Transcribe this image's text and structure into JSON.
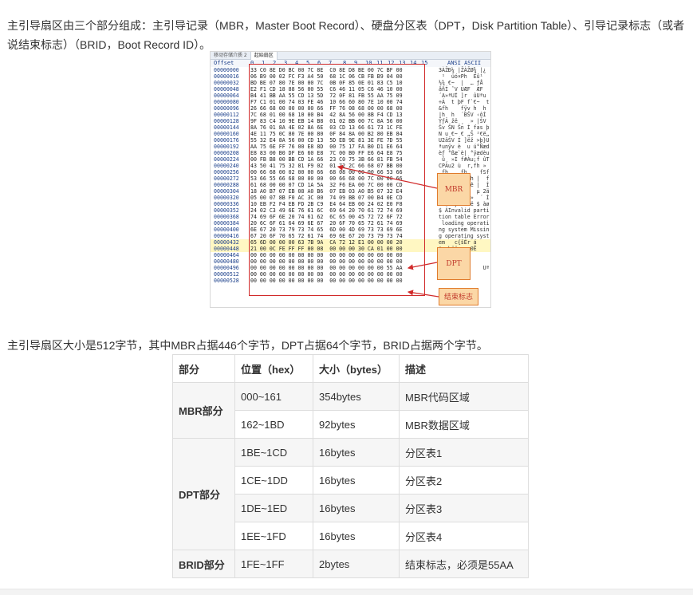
{
  "intro": "主引导扇区由三个部分组成：主引导记录（MBR，Master Boot Record）、硬盘分区表（DPT，Disk Partition Table）、引导记录标志（或者说结束标志）（BRID，Boot Record ID）。",
  "summary": "主引导扇区大小是512字节，其中MBR占据446个字节，DPT占据64个字节，BRID占据两个字节。",
  "figure": {
    "tabs": [
      "移动存储介质 2",
      "起始扇区"
    ],
    "header": {
      "offset_label": "Offset",
      "columns": [
        "0",
        "1",
        "2",
        "3",
        "4",
        "5",
        "6",
        "7",
        "8",
        "9",
        "10",
        "11",
        "12",
        "13",
        "14",
        "15"
      ],
      "ascii_label": "ANSI ASCII"
    },
    "rows": [
      {
        "off": "00000000",
        "hex": "33 C0 8E D0 BC 00 7C 8E  C0 8E D8 BE 00 7C BF 00",
        "asc": "3ÀŽÐ¼ |ŽÀŽØ¾ |¿"
      },
      {
        "off": "00000016",
        "hex": "06 B9 00 02 FC F3 A4 50  68 1C 06 CB FB B9 04 00",
        "asc": " ¹  üó¤Ph  Ëû¹"
      },
      {
        "off": "00000032",
        "hex": "BD BE 07 80 7E 00 00 7C  0B 0F 85 0E 01 83 C5 10",
        "asc": "½¾ €~  |  … ƒÅ"
      },
      {
        "off": "00000048",
        "hex": "E2 F1 CD 18 88 56 00 55  C6 46 11 05 C6 46 10 00",
        "asc": "âñÍ ˆV UÆF  ÆF"
      },
      {
        "off": "00000064",
        "hex": "B4 41 BB AA 55 CD 13 5D  72 0F 81 FB 55 AA 75 09",
        "asc": "´A»ªUÍ ]r  ûUªu"
      },
      {
        "off": "00000080",
        "hex": "F7 C1 01 00 74 03 FE 46  10 66 60 80 7E 10 00 74",
        "asc": "÷Á  t þF f`€~  t"
      },
      {
        "off": "00000096",
        "hex": "26 66 68 00 00 00 00 66  FF 76 08 68 00 00 68 00",
        "asc": "&fh    fÿv h  h"
      },
      {
        "off": "00000112",
        "hex": "7C 68 01 00 68 10 00 B4  42 8A 56 00 8B F4 CD 13",
        "asc": "|h  h  ´BŠV ‹ôÍ"
      },
      {
        "off": "00000128",
        "hex": "9F 83 C4 10 9E EB 14 B8  01 02 BB 00 7C 8A 56 00",
        "asc": "ŸƒÄ žë ¸  » |ŠV"
      },
      {
        "off": "00000144",
        "hex": "8A 76 01 8A 4E 02 8A 6E  03 CD 13 66 61 73 1C FE",
        "asc": "Šv ŠN Šn Í fas þ"
      },
      {
        "off": "00000160",
        "hex": "4E 11 75 0C 80 7E 00 80  0F 84 8A 00 B2 80 EB 84",
        "asc": "N u €~ € „Š ²€ë„"
      },
      {
        "off": "00000176",
        "hex": "55 32 E4 8A 56 00 CD 13  5D EB 9E 81 3E FE 7D 55",
        "asc": "U2äŠV Í ]ëž >þ}U"
      },
      {
        "off": "00000192",
        "hex": "AA 75 6E FF 76 00 E8 8D  00 75 17 FA B0 D1 E6 64",
        "asc": "ªunÿv è  u ú°Ñæd"
      },
      {
        "off": "00000208",
        "hex": "E8 83 00 B0 DF E6 60 E8  7C 00 B0 FF E6 64 E8 75",
        "asc": "èƒ °ßæ`è| °ÿædèu"
      },
      {
        "off": "00000224",
        "hex": "00 FB B8 00 BB CD 1A 66  23 C0 75 3B 66 81 FB 54",
        "asc": " û¸ »Í f#Àu;f ûT"
      },
      {
        "off": "00000240",
        "hex": "43 50 41 75 32 81 F9 02  01 72 2C 66 68 07 BB 00",
        "asc": "CPAu2 ù  r,fh »"
      },
      {
        "off": "00000256",
        "hex": "00 66 68 00 02 00 00 66  68 08 00 00 00 66 53 66",
        "asc": " fh    fh    fSf"
      },
      {
        "off": "00000272",
        "hex": "53 66 55 66 68 00 00 00  00 66 68 00 7C 00 00 66",
        "asc": "SfUfh    fh |  f"
      },
      {
        "off": "00000288",
        "hex": "61 68 00 00 07 CD 1A 5A  32 F6 EA 00 7C 00 00 CD",
        "asc": "ah   Í Z2öê |  Í"
      },
      {
        "off": "00000304",
        "hex": "18 A0 B7 07 EB 08 A0 B6  07 EB 03 A0 B5 07 32 E4",
        "asc": "  · ë  ¶ ë  µ 2ä"
      },
      {
        "off": "00000320",
        "hex": "05 00 07 8B F0 AC 3C 00  74 09 BB 07 00 B4 0E CD",
        "asc": "   ‹ð¬< t »  ´ Í"
      },
      {
        "off": "00000336",
        "hex": "10 EB F2 F4 EB FD 2B C9  E4 64 EB 00 24 02 E0 F8",
        "asc": " ëòôëý+Éädë $ àø"
      },
      {
        "off": "00000352",
        "hex": "24 02 C3 49 6E 76 61 6C  69 64 20 70 61 72 74 69",
        "asc": "$ ÃInvalid parti"
      },
      {
        "off": "00000368",
        "hex": "74 69 6F 6E 20 74 61 62  6C 65 00 45 72 72 6F 72",
        "asc": "tion table Error"
      },
      {
        "off": "00000384",
        "hex": "20 6C 6F 61 64 69 6E 67  20 6F 70 65 72 61 74 69",
        "asc": " loading operati"
      },
      {
        "off": "00000400",
        "hex": "6E 67 20 73 79 73 74 65  6D 00 4D 69 73 73 69 6E",
        "asc": "ng system Missin"
      },
      {
        "off": "00000416",
        "hex": "67 20 6F 70 65 72 61 74  69 6E 67 20 73 79 73 74",
        "asc": "g operating syst"
      },
      {
        "off": "00000432",
        "hex": "65 6D 00 00 00 63 7B 9A  CA 72 12 E1 00 00 00 20",
        "asc": "em   c{šÊr á"
      },
      {
        "off": "00000448",
        "hex": "21 00 0C FE FF FF 00 08  00 00 00 30 CA 01 00 00",
        "asc": "!  þÿÿ    0Ê"
      },
      {
        "off": "00000464",
        "hex": "00 00 00 00 00 00 00 00  00 00 00 00 00 00 00 00",
        "asc": ""
      },
      {
        "off": "00000480",
        "hex": "00 00 00 00 00 00 00 00  00 00 00 00 00 00 00 00",
        "asc": ""
      },
      {
        "off": "00000496",
        "hex": "00 00 00 00 00 00 00 00  00 00 00 00 00 00 55 AA",
        "asc": "              Uª"
      },
      {
        "off": "00000512",
        "hex": "00 00 00 00 00 00 00 00  00 00 00 00 00 00 00 00",
        "asc": ""
      },
      {
        "off": "00000528",
        "hex": "00 00 00 00 00 00 00 00  00 00 00 00 00 00 00 00",
        "asc": ""
      }
    ],
    "callouts": {
      "mbr": "MBR",
      "dpt": "DPT",
      "brid": "结束标志"
    }
  },
  "table": {
    "headers": [
      "部分",
      "位置（hex）",
      "大小（bytes）",
      "描述"
    ],
    "groups": {
      "mbr": "MBR部分",
      "dpt": "DPT部分",
      "brid": "BRID部分"
    },
    "rows": [
      {
        "pos": "000~161",
        "size": "354bytes",
        "desc": "MBR代码区域"
      },
      {
        "pos": "162~1BD",
        "size": "92bytes",
        "desc": "MBR数据区域"
      },
      {
        "pos": "1BE~1CD",
        "size": "16bytes",
        "desc": "分区表1"
      },
      {
        "pos": "1CE~1DD",
        "size": "16bytes",
        "desc": "分区表2"
      },
      {
        "pos": "1DE~1ED",
        "size": "16bytes",
        "desc": "分区表3"
      },
      {
        "pos": "1EE~1FD",
        "size": "16bytes",
        "desc": "分区表4"
      },
      {
        "pos": "1FE~1FF",
        "size": "2bytes",
        "desc": "结束标志，必须是55AA"
      }
    ]
  },
  "colors": {
    "callout_fill": "#fbd7a6",
    "callout_border": "#e07b2c",
    "callout_text": "#c0392b",
    "region_box": "#d12b2b",
    "table_shade": "#f6f6f6",
    "table_border": "#dddddd"
  }
}
